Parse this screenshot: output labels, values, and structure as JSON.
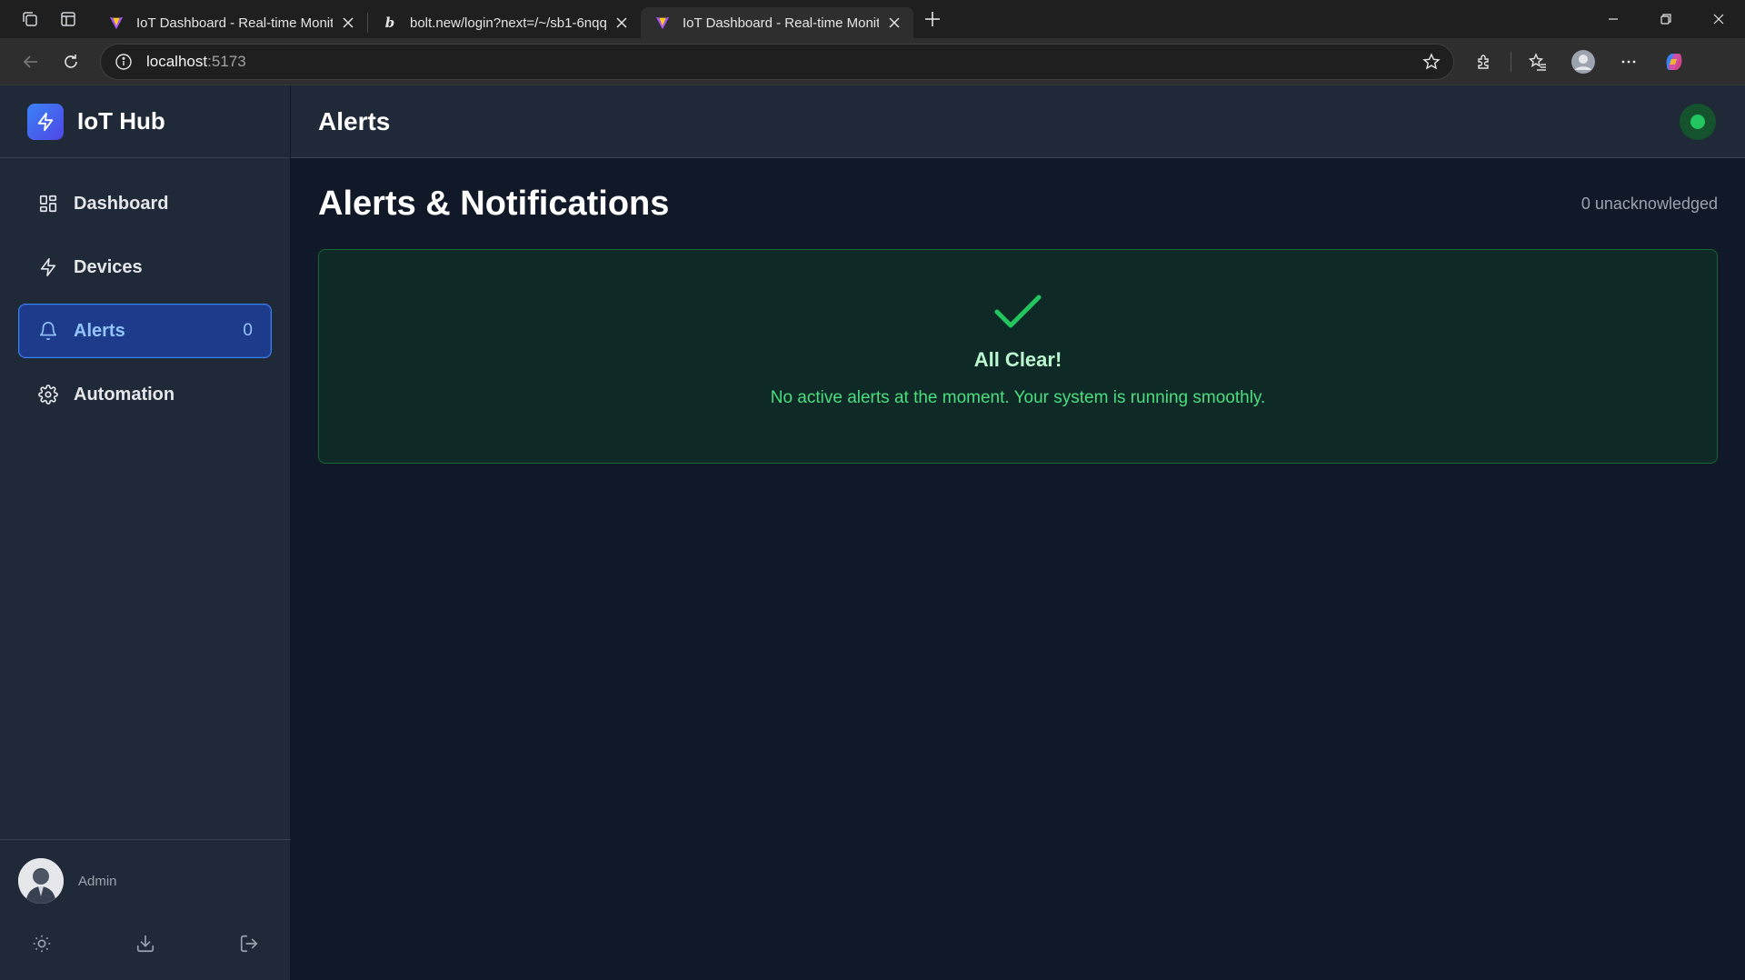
{
  "browser": {
    "tabs": [
      {
        "title": "IoT Dashboard - Real-time Monitoring",
        "active": false
      },
      {
        "title": "bolt.new/login?next=/~/sb1-6nqq",
        "active": false
      },
      {
        "title": "IoT Dashboard - Real-time Monitoring",
        "active": true
      }
    ],
    "url_host": "localhost",
    "url_port": ":5173"
  },
  "app": {
    "brand": "IoT Hub",
    "header_title": "Alerts",
    "connection_status_color": "#22c55e"
  },
  "sidebar": {
    "items": [
      {
        "label": "Dashboard",
        "icon": "dashboard-grid-icon",
        "active": false
      },
      {
        "label": "Devices",
        "icon": "lightning-icon",
        "active": false
      },
      {
        "label": "Alerts",
        "icon": "bell-icon",
        "active": true,
        "badge": "0"
      },
      {
        "label": "Automation",
        "icon": "gear-icon",
        "active": false
      }
    ],
    "user": {
      "name": "Admin"
    },
    "footer": [
      "sun-icon",
      "download-icon",
      "logout-icon"
    ]
  },
  "main": {
    "title": "Alerts & Notifications",
    "unacknowledged": "0 unacknowledged",
    "empty_state": {
      "title": "All Clear!",
      "message": "No active alerts at the moment. Your system is running smoothly."
    }
  },
  "colors": {
    "accent": "#3b82f6",
    "success": "#22c55e",
    "background": "#111827",
    "panel": "#1f2937"
  }
}
